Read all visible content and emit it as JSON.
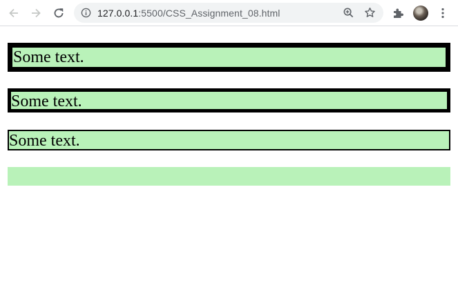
{
  "browser": {
    "url_host": "127.0.0.1",
    "url_rest": ":5500/CSS_Assignment_08.html"
  },
  "boxes": [
    {
      "text": "Some text."
    },
    {
      "text": "Some text."
    },
    {
      "text": "Some text."
    },
    {
      "text": ""
    }
  ],
  "colors": {
    "box_background": "#b9f2b9",
    "border": "#000000"
  }
}
